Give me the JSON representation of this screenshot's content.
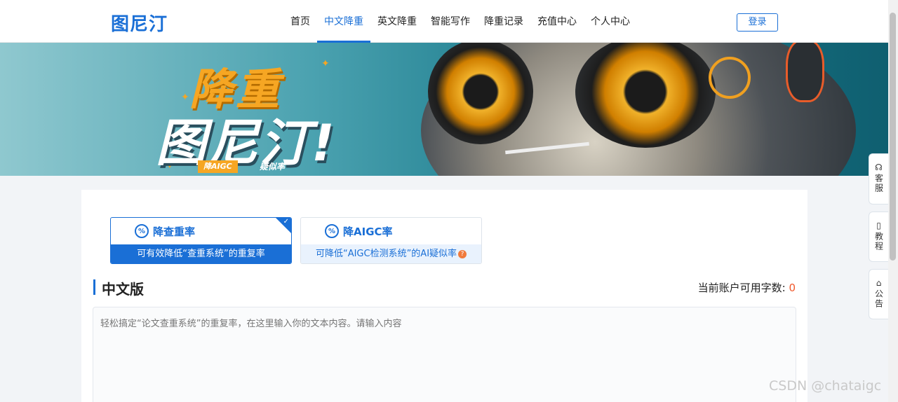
{
  "header": {
    "logo": "图尼汀",
    "nav": [
      "首页",
      "中文降重",
      "英文降重",
      "智能写作",
      "降重记录",
      "充值中心",
      "个人中心"
    ],
    "active_nav": "中文降重",
    "login_label": "登录"
  },
  "banner": {
    "title_line1": "降重",
    "title_line2": "图尼汀!",
    "tag": "降AIGC",
    "tag_suffix": "疑似率"
  },
  "modes": [
    {
      "title": "降查重率",
      "subtitle": "可有效降低“查重系统”的重复率",
      "icon": "percent-icon",
      "selected": true
    },
    {
      "title": "降AIGC率",
      "subtitle": "可降低“AIGC检测系统”的AI疑似率",
      "icon": "percent-icon",
      "selected": false
    }
  ],
  "section": {
    "title": "中文版",
    "quota_label": "当前账户可用字数:",
    "quota_value": "0"
  },
  "editor": {
    "placeholder": "轻松搞定“论文查重系统”的重复率，在这里输入你的文本内容。请输入内容"
  },
  "side_buttons": [
    {
      "label": "客服",
      "icon": "headset-icon"
    },
    {
      "label": "教程",
      "icon": "book-icon"
    },
    {
      "label": "公告",
      "icon": "notice-icon"
    }
  ],
  "watermark": "CSDN @chataigc",
  "colors": {
    "primary": "#1a6fd6",
    "accent": "#f0582c",
    "banner_orange": "#f6a623"
  }
}
